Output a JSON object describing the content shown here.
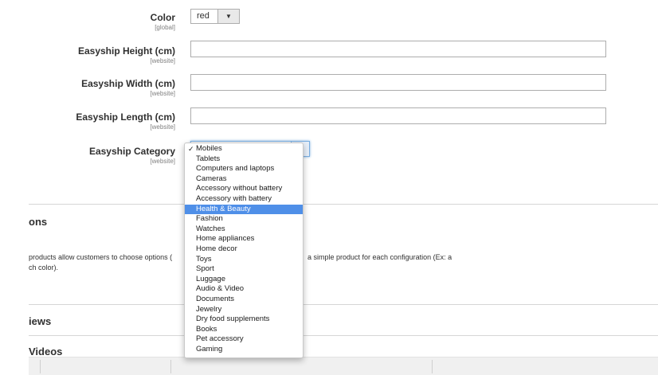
{
  "fields": {
    "color": {
      "label": "Color",
      "scope": "[global]",
      "value": "red",
      "arrow": "▼"
    },
    "height": {
      "label": "Easyship Height (cm)",
      "scope": "[website]",
      "value": ""
    },
    "width": {
      "label": "Easyship Width (cm)",
      "scope": "[website]",
      "value": ""
    },
    "length": {
      "label": "Easyship Length (cm)",
      "scope": "[website]",
      "value": ""
    },
    "category": {
      "label": "Easyship Category",
      "scope": "[website]",
      "selected": "Mobiles",
      "highlighted": "Health & Beauty",
      "checkmark": "✓",
      "options": [
        "Mobiles",
        "Tablets",
        "Computers and laptops",
        "Cameras",
        "Accessory without battery",
        "Accessory with battery",
        "Health & Beauty",
        "Fashion",
        "Watches",
        "Home appliances",
        "Home decor",
        "Toys",
        "Sport",
        "Luggage",
        "Audio & Video",
        "Documents",
        "Jewelry",
        "Dry food supplements",
        "Books",
        "Pet accessory",
        "Gaming"
      ]
    }
  },
  "sections": {
    "options": {
      "title": "ons",
      "desc_line1_a": "products allow customers to choose options (",
      "desc_line1_b": "a simple product for each configuration (Ex: a",
      "desc_line2": "ch color)."
    },
    "reviews": {
      "title": "iews"
    },
    "videos": {
      "title": "Videos"
    }
  }
}
